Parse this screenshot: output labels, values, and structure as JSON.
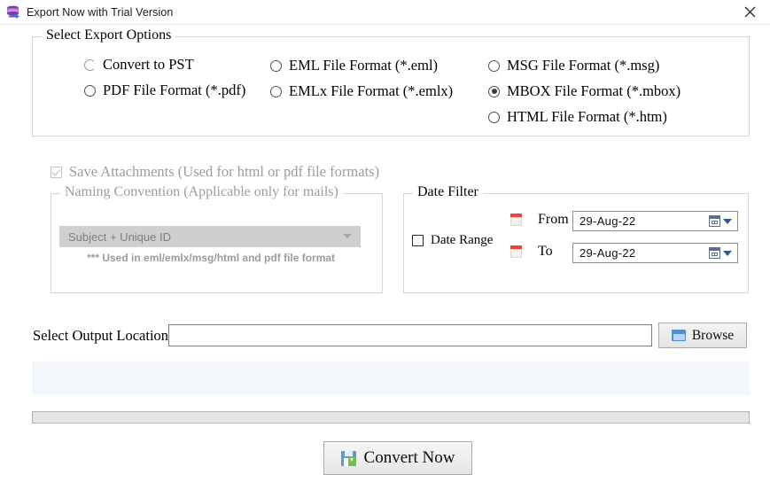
{
  "window": {
    "title": "Export Now with Trial Version",
    "app_icon": "database-export-icon",
    "close_icon": "close-icon"
  },
  "export_options": {
    "legend": "Select Export Options",
    "items": [
      {
        "label": "Convert to PST",
        "checked": false,
        "col": 1,
        "row": 1
      },
      {
        "label": "PDF File Format (*.pdf)",
        "checked": false,
        "col": 1,
        "row": 2
      },
      {
        "label": "EML File  Format (*.eml)",
        "checked": false,
        "col": 2,
        "row": 1
      },
      {
        "label": "EMLx File  Format (*.emlx)",
        "checked": false,
        "col": 2,
        "row": 2
      },
      {
        "label": "MSG File Format (*.msg)",
        "checked": false,
        "col": 3,
        "row": 1
      },
      {
        "label": "MBOX File Format (*.mbox)",
        "checked": true,
        "col": 3,
        "row": 2
      },
      {
        "label": "HTML File  Format (*.htm)",
        "checked": false,
        "col": 3,
        "row": 3
      }
    ]
  },
  "save_attachments": {
    "label": "Save Attachments (Used for html or pdf file formats)",
    "checked": true,
    "enabled": false
  },
  "naming_convention": {
    "legend": "Naming Convention (Applicable only for mails)",
    "selected": "Subject + Unique ID",
    "options": [
      "Subject + Unique ID"
    ],
    "hint": "*** Used in eml/emlx/msg/html and pdf file format",
    "enabled": false
  },
  "date_filter": {
    "legend": "Date Filter",
    "date_range_label": "Date Range",
    "date_range_checked": false,
    "from_label": "From",
    "from_value": "29-Aug-22",
    "to_label": "To",
    "to_value": "29-Aug-22",
    "calendar_icon": "calendar-icon"
  },
  "output": {
    "label": "Select Output Location",
    "value": "",
    "placeholder": "",
    "browse_label": "Browse",
    "browse_icon": "folder-icon"
  },
  "status": {
    "message": "",
    "progress_percent": 0
  },
  "actions": {
    "convert_label": "Convert Now",
    "convert_icon": "save-icon"
  },
  "colors": {
    "accent_blue": "#2b5797",
    "panel_blue": "#f3f6fb",
    "calendar_red": "#e8453c",
    "progress_green": "#06b025",
    "disabled_gray": "#9c9c9c"
  }
}
